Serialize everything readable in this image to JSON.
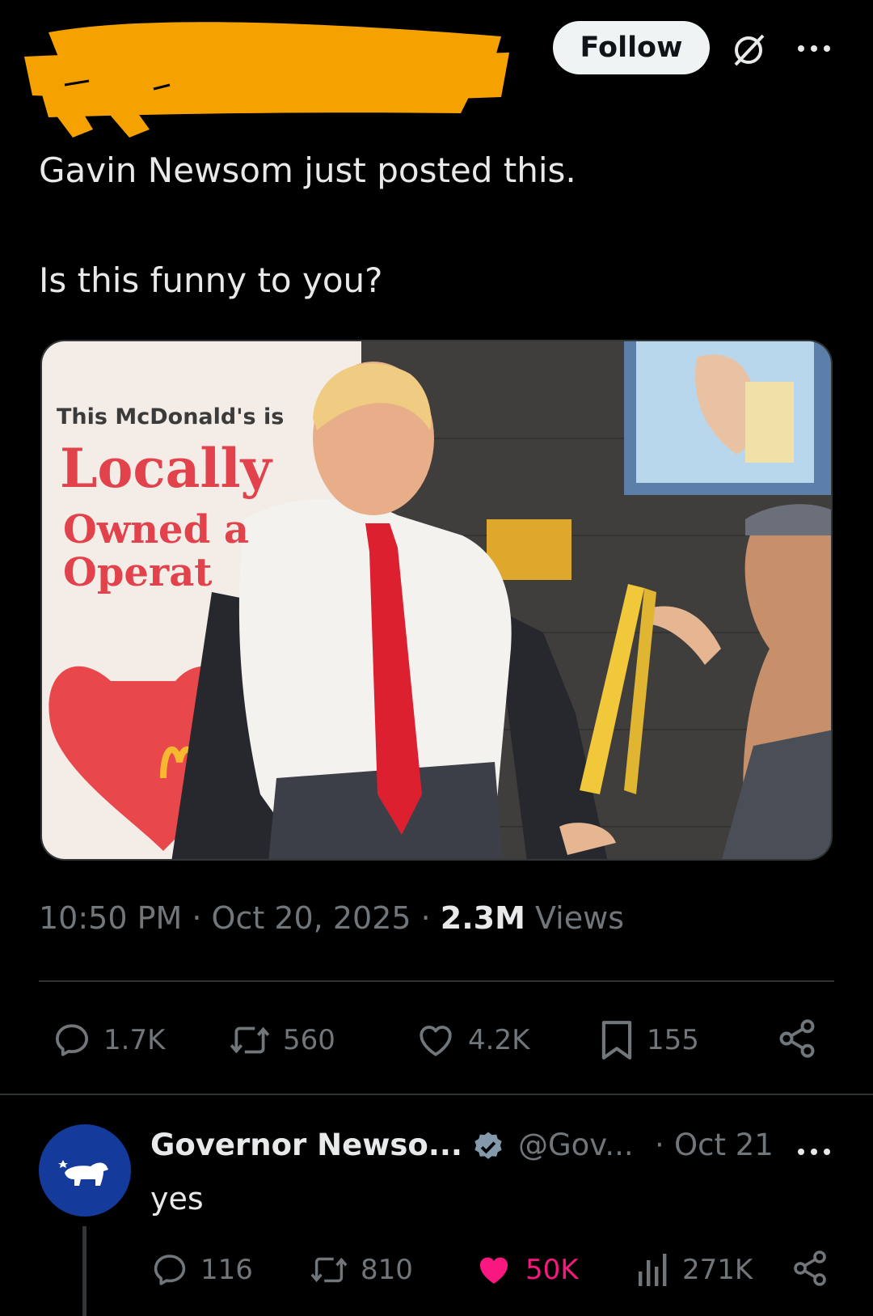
{
  "header": {
    "follow_label": "Follow",
    "grok_icon": "grok-slash-icon",
    "more_icon": "more-horizontal-icon",
    "redaction_color": "#f5a200"
  },
  "tweet": {
    "line1": "Gavin Newsom just posted this.",
    "line2": "Is this funny to you?",
    "media_text": {
      "line1": "This McDonald's is",
      "line2": "Locally",
      "line3": "Owned a",
      "line4": "Operat"
    },
    "time": "10:50 PM",
    "sep": " · ",
    "date": "Oct 20, 2025",
    "views_count": "2.3M",
    "views_label": " Views"
  },
  "actions": {
    "replies": "1.7K",
    "reposts": "560",
    "likes": "4.2K",
    "bookmarks": "155"
  },
  "reply": {
    "name": "Governor Newso...",
    "handle": "@Gov...",
    "dot": "·",
    "date": "Oct 21",
    "text": "yes",
    "replies": "116",
    "reposts": "810",
    "likes": "50K",
    "views": "271K",
    "like_color": "#f91880",
    "avatar_bg": "#143b9c"
  }
}
